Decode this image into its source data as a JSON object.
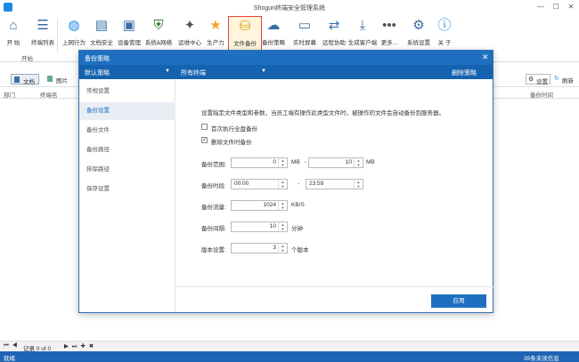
{
  "window": {
    "title": "Shogun终端安全管理系统",
    "min": "—",
    "max": "☐",
    "close": "✕"
  },
  "ribbon": {
    "buttons": [
      {
        "label": "开 始",
        "icon": "home-icon",
        "color": "#3a6ea5"
      },
      {
        "label": "终端列表",
        "icon": "list-icon",
        "color": "#3a6ea5"
      },
      {
        "label": "上网行为",
        "icon": "globe-icon",
        "color": "#1e88e5"
      },
      {
        "label": "文档安全",
        "icon": "document-icon",
        "color": "#3a6ea5"
      },
      {
        "label": "设备管理",
        "icon": "device-icon",
        "color": "#3a6ea5"
      },
      {
        "label": "系统&网络",
        "icon": "shield-icon",
        "color": "#2e7d32"
      },
      {
        "label": "运维中心",
        "icon": "wand-icon",
        "color": "#555555"
      },
      {
        "label": "生产力",
        "icon": "star-icon",
        "color": "#f5a623"
      },
      {
        "label": "文件备份",
        "icon": "database-icon",
        "color": "#e0a020"
      },
      {
        "label": "备份策略",
        "icon": "cloud-icon",
        "color": "#3a6ea5"
      },
      {
        "label": "实时屏幕",
        "icon": "monitor-icon",
        "color": "#3a6ea5"
      },
      {
        "label": "远程协助",
        "icon": "remote-icon",
        "color": "#3a6ea5"
      },
      {
        "label": "生成客户端",
        "icon": "download-icon",
        "color": "#3a6ea5"
      },
      {
        "label": "更多...",
        "icon": "more-icon",
        "color": "#555555"
      },
      {
        "label": "系统设置",
        "icon": "gear-icon",
        "color": "#3a6ea5"
      },
      {
        "label": "关 于",
        "icon": "info-icon",
        "color": "#1e88e5"
      }
    ],
    "group_label": "开始"
  },
  "subbar": {
    "doc": "文档",
    "img": "图片",
    "settings": "设置",
    "refresh": "刷新"
  },
  "grid": {
    "cols": [
      "部门",
      "终端名",
      "备份时间"
    ]
  },
  "pager": {
    "text": "记录 0 of 0"
  },
  "status": {
    "left": "就绪",
    "right": "35条未读信息"
  },
  "dialog": {
    "title": "备份策略",
    "policy": "默认策略",
    "terminal": "所有终端",
    "delete": "删除策略",
    "nav": [
      "常规设置",
      "备份设置",
      "备份文件",
      "备份路径",
      "排除路径",
      "保存设置"
    ],
    "active_nav": 1,
    "desc": "设置指定文件类型和参数，当员工端有操作此类型文件时，被操作的文件会自动备份到服务器。",
    "opt1": "首次执行全盘备份",
    "opt2": "删除文件时备份",
    "range_label": "备份范围:",
    "range_min": "0",
    "range_max": "10",
    "mb": "MB",
    "dash": "-",
    "time_label": "备份时段:",
    "time_start": "00:00",
    "time_end": "23:59",
    "flow_label": "备份流量:",
    "flow": "1024",
    "flow_unit": "KB/S",
    "interval_label": "备份间隔:",
    "interval": "10",
    "interval_unit": "分钟",
    "version_label": "版本设置:",
    "version": "3",
    "version_unit": "个版本",
    "apply": "应用",
    "close": "✕"
  }
}
